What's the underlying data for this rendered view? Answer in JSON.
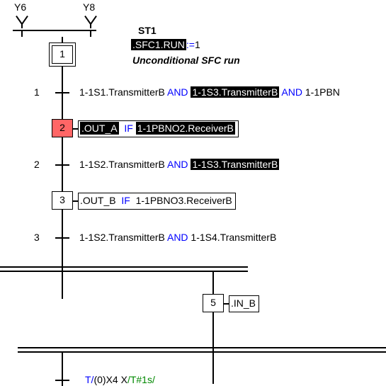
{
  "topLabels": {
    "y6": "Y6",
    "y8": "Y8"
  },
  "header": {
    "st": "ST1",
    "assign": {
      "lhs": ".SFC1.RUN",
      "op": ":=",
      "rhs": "1"
    },
    "comment": "Unconditional SFC run"
  },
  "steps": {
    "s1": "1",
    "s2": "2",
    "s3": "3",
    "s5": "5"
  },
  "transitions": {
    "t1": {
      "num": "1",
      "expr": [
        "1-1S1.TransmitterB ",
        "AND",
        " ",
        "1-1S3.TransmitterB",
        " ",
        "AND",
        " 1-1PBN"
      ]
    },
    "t2": {
      "num": "2",
      "expr": [
        "1-1S2.TransmitterB ",
        "AND",
        " ",
        "1-1S3.TransmitterB"
      ]
    },
    "t3": {
      "num": "3",
      "expr": [
        "1-1S2.TransmitterB ",
        "AND",
        " 1-1S4.TransmitterB"
      ]
    }
  },
  "actions": {
    "a2": {
      "out": ".OUT_A",
      "ifkw": "IF",
      "cond": "1-1PBNO2.ReceiverB"
    },
    "a3": {
      "out": ".OUT_B",
      "ifkw": "IF",
      "cond": "1-1PBNO3.ReceiverB"
    },
    "a5": {
      "out": ".IN_B"
    }
  },
  "footer": {
    "expr": [
      "T/",
      "(0)",
      "X4 X",
      "/T#1s/"
    ]
  }
}
